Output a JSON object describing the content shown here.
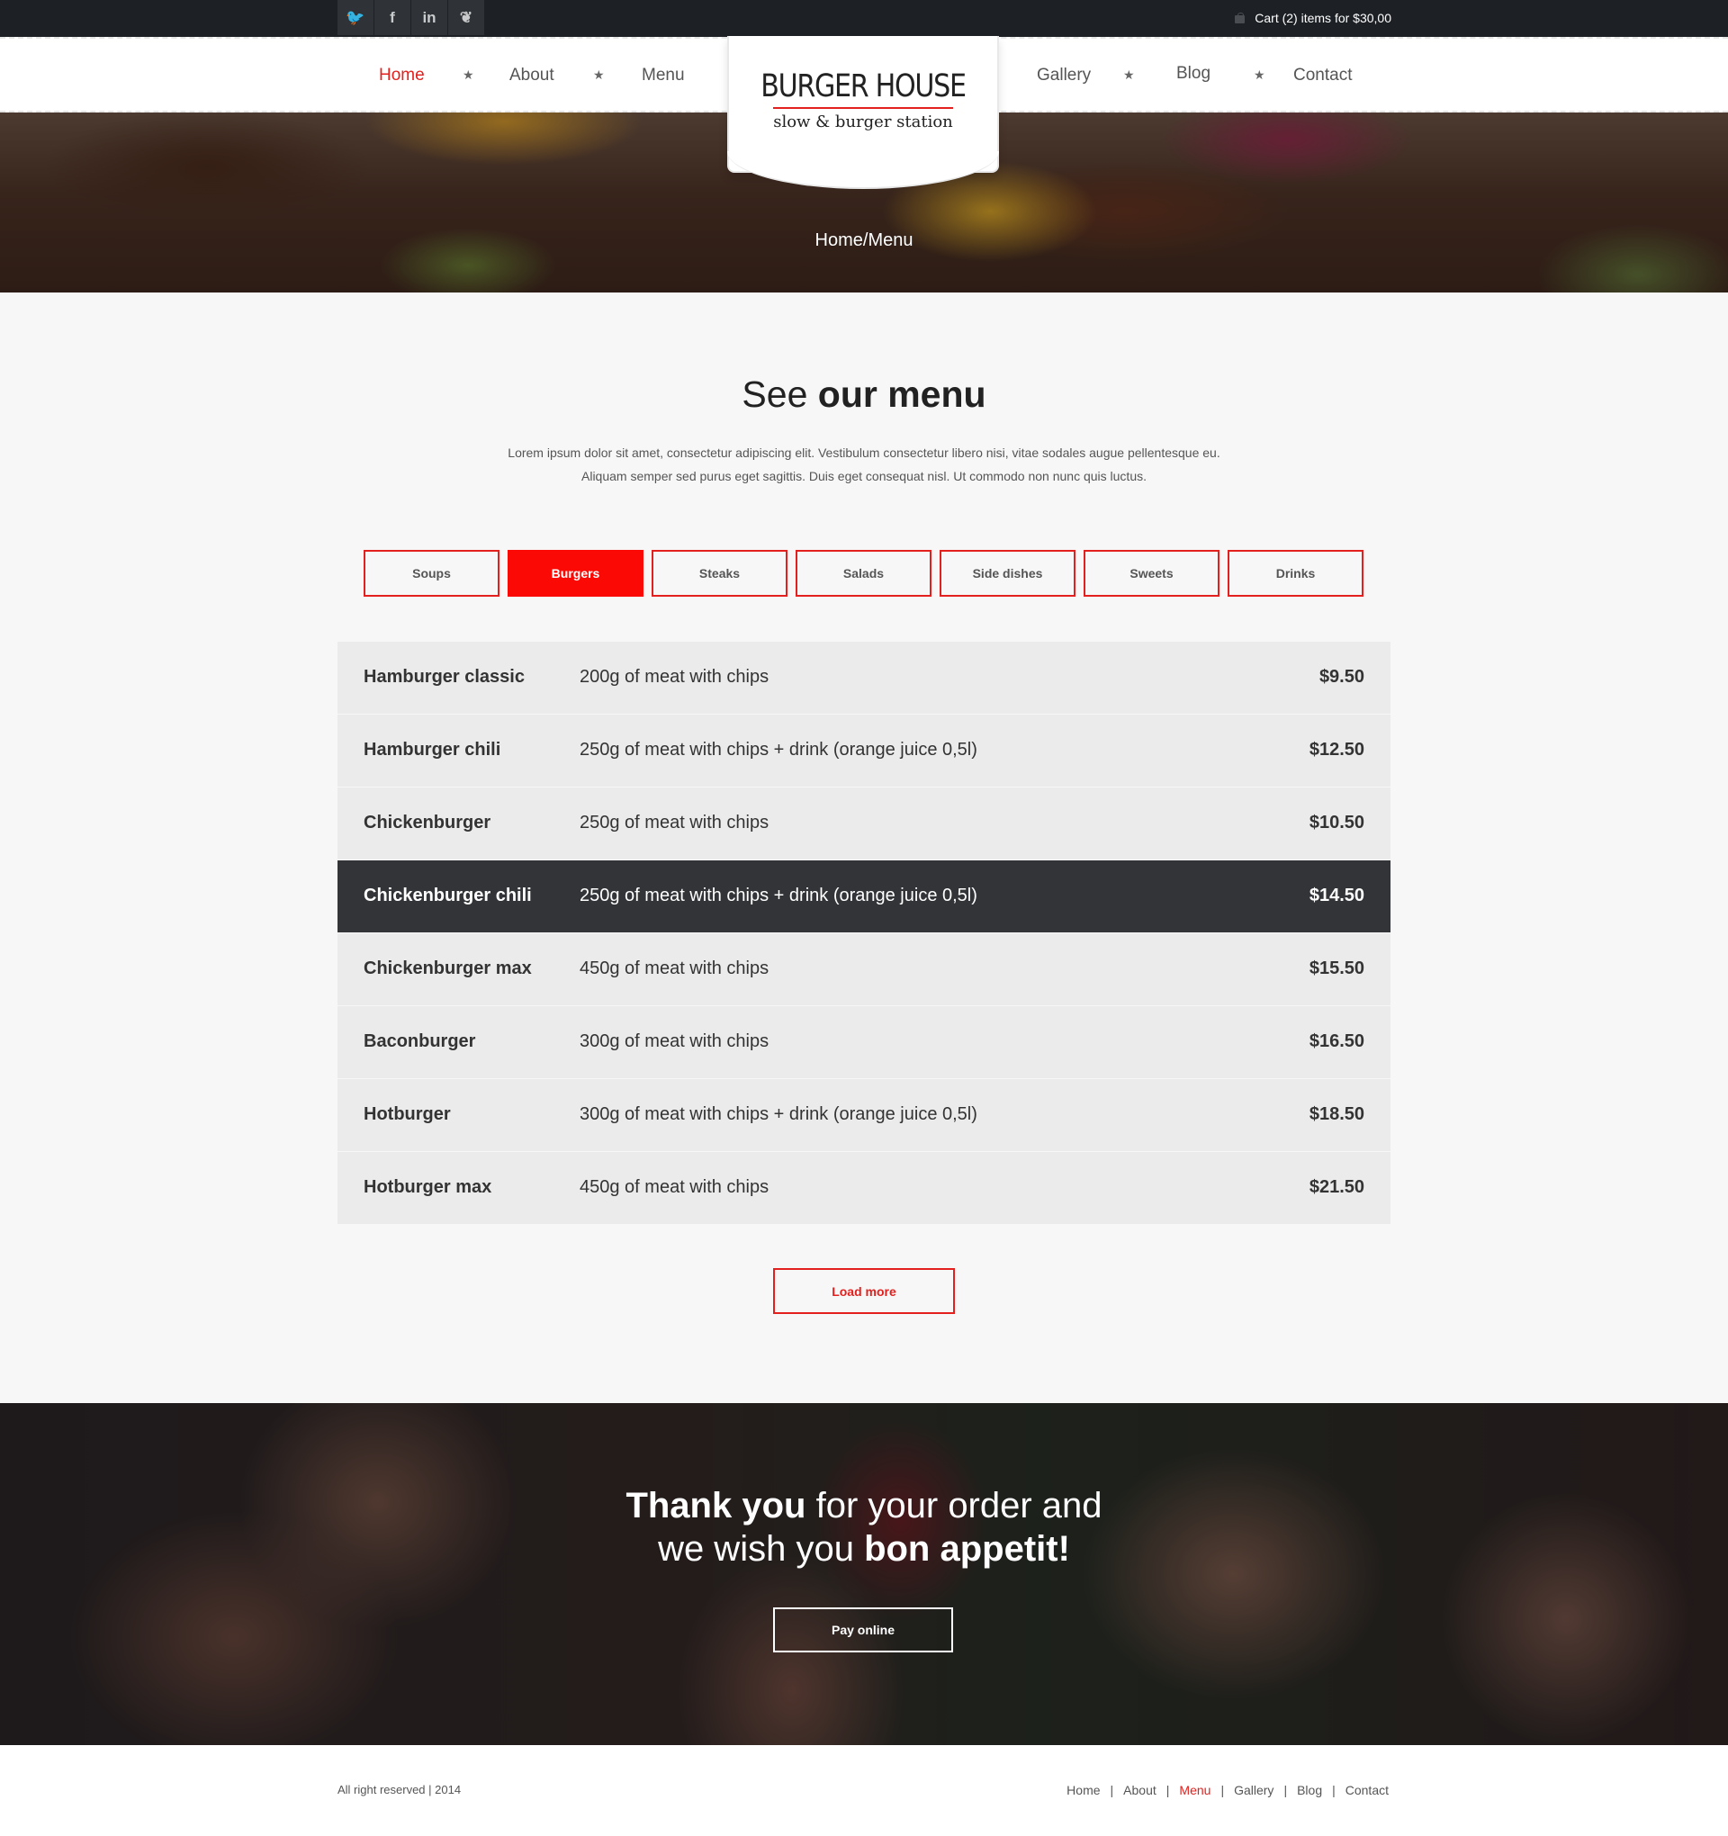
{
  "topbar": {
    "social": [
      {
        "icon": "twitter-icon",
        "glyph": "🐦"
      },
      {
        "icon": "facebook-icon",
        "glyph": "f"
      },
      {
        "icon": "linkedin-icon",
        "glyph": "in"
      },
      {
        "icon": "evernote-icon",
        "glyph": "❦"
      }
    ],
    "cart_text": "Cart (2) items for $30,00"
  },
  "nav": {
    "items": [
      "Home",
      "About",
      "Menu",
      "Gallery",
      "Blog",
      "Contact"
    ],
    "active": "Home",
    "separator": "★"
  },
  "logo": {
    "title": "BURGER HOUSE",
    "subtitle": "slow & burger station"
  },
  "hero": {
    "breadcrumb": "Home/Menu"
  },
  "menu_section": {
    "title_light": "See",
    "title_bold": "our menu",
    "intro_line1": "Lorem ipsum dolor sit amet, consectetur adipiscing elit. Vestibulum consectetur libero nisi, vitae sodales augue pellentesque eu.",
    "intro_line2": "Aliquam semper sed purus eget sagittis. Duis eget consequat nisl. Ut commodo non nunc quis luctus.",
    "tabs": [
      "Soups",
      "Burgers",
      "Steaks",
      "Salads",
      "Side dishes",
      "Sweets",
      "Drinks"
    ],
    "active_tab": "Burgers",
    "items": [
      {
        "name": "Hamburger classic",
        "desc": "200g of meat with chips",
        "price": "$9.50"
      },
      {
        "name": "Hamburger chili",
        "desc": "250g of meat with chips + drink (orange juice 0,5l)",
        "price": "$12.50"
      },
      {
        "name": "Chickenburger",
        "desc": "250g of meat with chips",
        "price": "$10.50"
      },
      {
        "name": "Chickenburger chili",
        "desc": "250g of meat with chips + drink (orange juice 0,5l)",
        "price": "$14.50"
      },
      {
        "name": "Chickenburger max",
        "desc": "450g of meat with chips",
        "price": "$15.50"
      },
      {
        "name": "Baconburger",
        "desc": "300g of meat with chips",
        "price": "$16.50"
      },
      {
        "name": "Hotburger",
        "desc": "300g of meat with chips + drink (orange juice 0,5l)",
        "price": "$18.50"
      },
      {
        "name": "Hotburger max",
        "desc": "450g of meat with chips",
        "price": "$21.50"
      }
    ],
    "highlighted_item": "Chickenburger chili",
    "load_more": "Load more"
  },
  "banner": {
    "line1_bold": "Thank you",
    "line1_rest": "for your order and",
    "line2_light": "we wish you",
    "line2_bold": "bon appetit!",
    "pay_button": "Pay online"
  },
  "footer": {
    "copyright": "All right reserved | 2014",
    "links": [
      "Home",
      "About",
      "Menu",
      "Gallery",
      "Blog",
      "Contact"
    ],
    "active": "Menu",
    "separator": "|"
  },
  "colors": {
    "accent": "#e3201d",
    "tab_active": "#fb0a05",
    "topbar": "#1d2125",
    "row": "#ebebeb",
    "row_dark": "#323437"
  }
}
